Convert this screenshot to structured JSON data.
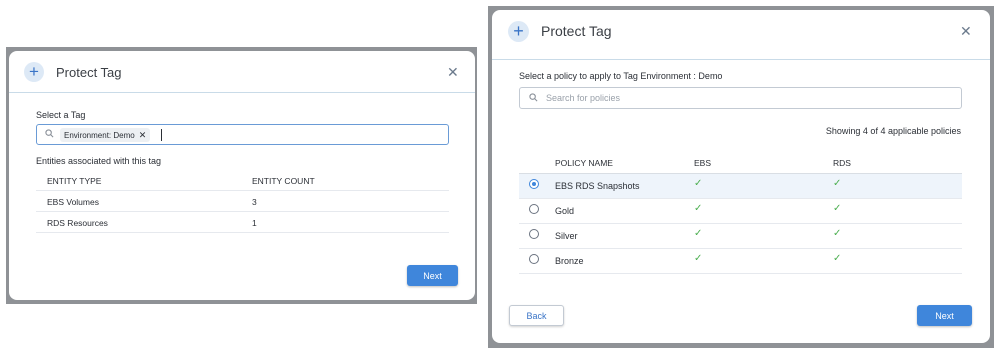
{
  "left_modal": {
    "title": "Protect Tag",
    "select_label": "Select a Tag",
    "tag_chip": "Environment: Demo",
    "entities_label": "Entities associated with this tag",
    "columns": [
      "ENTITY TYPE",
      "ENTITY COUNT"
    ],
    "rows": [
      {
        "type": "EBS Volumes",
        "count": "3"
      },
      {
        "type": "RDS Resources",
        "count": "1"
      }
    ],
    "next_label": "Next"
  },
  "right_modal": {
    "title": "Protect Tag",
    "prompt": "Select a policy to apply to Tag Environment : Demo",
    "search_placeholder": "Search for policies",
    "showing_text": "Showing 4 of 4 applicable policies",
    "columns": [
      "POLICY NAME",
      "EBS",
      "RDS"
    ],
    "policies": [
      {
        "name": "EBS RDS Snapshots",
        "selected": true
      },
      {
        "name": "Gold",
        "selected": false
      },
      {
        "name": "Silver",
        "selected": false
      },
      {
        "name": "Bronze",
        "selected": false
      }
    ],
    "back_label": "Back",
    "next_label": "Next"
  },
  "icons": {
    "add": "plus-icon",
    "close": "close-icon",
    "search": "search-icon",
    "remove_chip": "remove-icon",
    "check": "checkmark-icon"
  },
  "colors": {
    "accent": "#3f86db",
    "check": "#4caf50",
    "selected_row": "#eef4fb"
  }
}
